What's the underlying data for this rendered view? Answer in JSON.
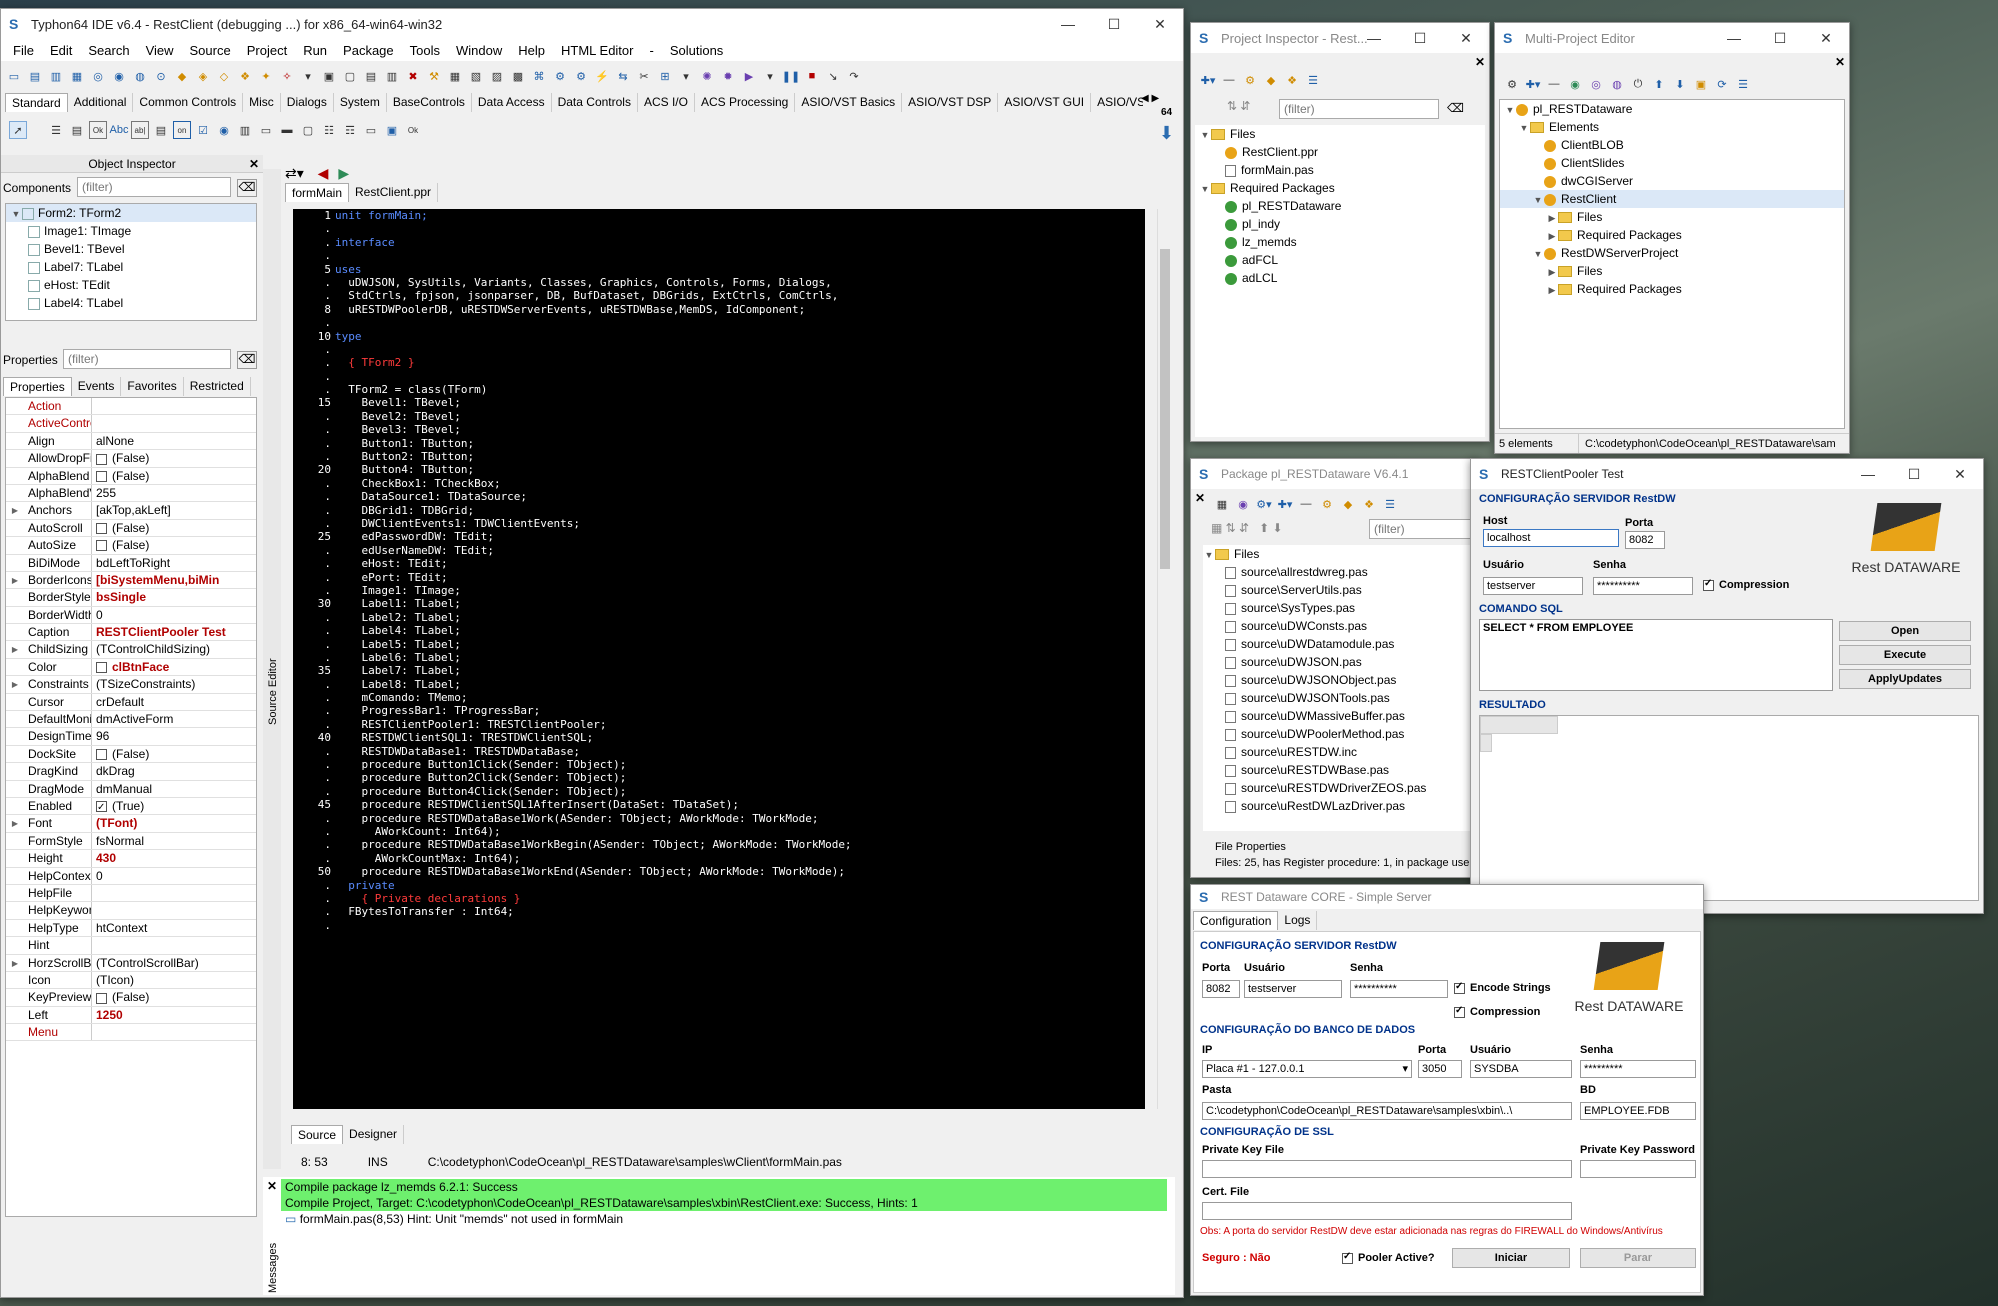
{
  "ide": {
    "title": "Typhon64 IDE v6.4 - RestClient (debugging ...) for x86_64-win64-win32",
    "menu": [
      "File",
      "Edit",
      "Search",
      "View",
      "Source",
      "Project",
      "Run",
      "Package",
      "Tools",
      "Window",
      "Help",
      "HTML Editor",
      "-",
      "Solutions"
    ],
    "palette_tabs": [
      "Standard",
      "Additional",
      "Common Controls",
      "Misc",
      "Dialogs",
      "System",
      "BaseControls",
      "Data Access",
      "Data Controls",
      "ACS I/O",
      "ACS Processing",
      "ASIO/VST Basics",
      "ASIO/VST DSP",
      "ASIO/VST GUI",
      "ASIO/VST C"
    ],
    "palette_icon_label": "64"
  },
  "object_inspector": {
    "title": "Object Inspector",
    "components_label": "Components",
    "filter_placeholder": "(filter)",
    "tree": [
      "Form2: TForm2",
      "Image1: TImage",
      "Bevel1: TBevel",
      "Label7: TLabel",
      "eHost: TEdit",
      "Label4: TLabel"
    ],
    "properties_label": "Properties",
    "tabs": [
      "Properties",
      "Events",
      "Favorites",
      "Restricted"
    ],
    "props": [
      {
        "name": "Action",
        "value": "",
        "red": true
      },
      {
        "name": "ActiveControl",
        "value": "",
        "red": true
      },
      {
        "name": "Align",
        "value": "alNone"
      },
      {
        "name": "AllowDropFiles",
        "value": "(False)",
        "check": false
      },
      {
        "name": "AlphaBlend",
        "value": "(False)",
        "check": false
      },
      {
        "name": "AlphaBlendValu",
        "value": "255"
      },
      {
        "name": "Anchors",
        "value": "[akTop,akLeft]",
        "exp": true
      },
      {
        "name": "AutoScroll",
        "value": "(False)",
        "check": false
      },
      {
        "name": "AutoSize",
        "value": "(False)",
        "check": false
      },
      {
        "name": "BiDiMode",
        "value": "bdLeftToRight"
      },
      {
        "name": "BorderIcons",
        "value": "[biSystemMenu,biMin",
        "exp": true,
        "bold": true
      },
      {
        "name": "BorderStyle",
        "value": "bsSingle",
        "bold": true
      },
      {
        "name": "BorderWidth",
        "value": "0"
      },
      {
        "name": "Caption",
        "value": "RESTClientPooler Test",
        "bold": true
      },
      {
        "name": "ChildSizing",
        "value": "(TControlChildSizing)",
        "exp": true
      },
      {
        "name": "Color",
        "value": "clBtnFace",
        "bold": true,
        "swatch": true
      },
      {
        "name": "Constraints",
        "value": "(TSizeConstraints)",
        "exp": true
      },
      {
        "name": "Cursor",
        "value": "crDefault"
      },
      {
        "name": "DefaultMonitor",
        "value": "dmActiveForm"
      },
      {
        "name": "DesignTimePPI",
        "value": "96"
      },
      {
        "name": "DockSite",
        "value": "(False)",
        "check": false
      },
      {
        "name": "DragKind",
        "value": "dkDrag"
      },
      {
        "name": "DragMode",
        "value": "dmManual"
      },
      {
        "name": "Enabled",
        "value": "(True)",
        "check": true
      },
      {
        "name": "Font",
        "value": "(TFont)",
        "exp": true,
        "bold": true
      },
      {
        "name": "FormStyle",
        "value": "fsNormal"
      },
      {
        "name": "Height",
        "value": "430",
        "bold": true
      },
      {
        "name": "HelpContext",
        "value": "0"
      },
      {
        "name": "HelpFile",
        "value": ""
      },
      {
        "name": "HelpKeyword",
        "value": ""
      },
      {
        "name": "HelpType",
        "value": "htContext"
      },
      {
        "name": "Hint",
        "value": ""
      },
      {
        "name": "HorzScrollBar",
        "value": "(TControlScrollBar)",
        "exp": true
      },
      {
        "name": "Icon",
        "value": "(TIcon)"
      },
      {
        "name": "KeyPreview",
        "value": "(False)",
        "check": false
      },
      {
        "name": "Left",
        "value": "1250",
        "bold": true
      },
      {
        "name": "Menu",
        "value": "",
        "red": true
      }
    ]
  },
  "editor": {
    "tabs": [
      "formMain",
      "RestClient.ppr"
    ],
    "side_label": "Source Editor",
    "bottom_tabs": [
      "Source",
      "Designer"
    ],
    "cursor_pos": "8: 53",
    "mode": "INS",
    "file_path": "C:\\codetyphon\\CodeOcean\\pl_RESTDataware\\samples\\wClient\\formMain.pas",
    "gutter": [
      "1",
      ".",
      ".",
      ".",
      "5",
      ".",
      ".",
      "8",
      ".",
      "10",
      ".",
      ".",
      ".",
      ".",
      "15",
      ".",
      ".",
      ".",
      ".",
      "20",
      ".",
      ".",
      ".",
      ".",
      "25",
      ".",
      ".",
      ".",
      ".",
      "30",
      ".",
      ".",
      ".",
      ".",
      "35",
      ".",
      ".",
      ".",
      ".",
      "40",
      ".",
      ".",
      ".",
      ".",
      "45",
      ".",
      ".",
      ".",
      ".",
      "50",
      ".",
      ".",
      ".",
      "."
    ],
    "lines": [
      "unit formMain;",
      "",
      "interface",
      "",
      "uses",
      "  uDWJSON, SysUtils, Variants, Classes, Graphics, Controls, Forms, Dialogs,",
      "  StdCtrls, fpjson, jsonparser, DB, BufDataset, DBGrids, ExtCtrls, ComCtrls,",
      "  uRESTDWPoolerDB, uRESTDWServerEvents, uRESTDWBase,MemDS, IdComponent;",
      "",
      "type",
      "",
      "  { TForm2 }",
      "",
      "  TForm2 = class(TForm)",
      "    Bevel1: TBevel;",
      "    Bevel2: TBevel;",
      "    Bevel3: TBevel;",
      "    Button1: TButton;",
      "    Button2: TButton;",
      "    Button4: TButton;",
      "    CheckBox1: TCheckBox;",
      "    DataSource1: TDataSource;",
      "    DBGrid1: TDBGrid;",
      "    DWClientEvents1: TDWClientEvents;",
      "    edPasswordDW: TEdit;",
      "    edUserNameDW: TEdit;",
      "    eHost: TEdit;",
      "    ePort: TEdit;",
      "    Image1: TImage;",
      "    Label1: TLabel;",
      "    Label2: TLabel;",
      "    Label4: TLabel;",
      "    Label5: TLabel;",
      "    Label6: TLabel;",
      "    Label7: TLabel;",
      "    Label8: TLabel;",
      "    mComando: TMemo;",
      "    ProgressBar1: TProgressBar;",
      "    RESTClientPooler1: TRESTClientPooler;",
      "    RESTDWClientSQL1: TRESTDWClientSQL;",
      "    RESTDWDataBase1: TRESTDWDataBase;",
      "    procedure Button1Click(Sender: TObject);",
      "    procedure Button2Click(Sender: TObject);",
      "    procedure Button4Click(Sender: TObject);",
      "    procedure RESTDWClientSQL1AfterInsert(DataSet: TDataSet);",
      "    procedure RESTDWDataBase1Work(ASender: TObject; AWorkMode: TWorkMode;",
      "      AWorkCount: Int64);",
      "    procedure RESTDWDataBase1WorkBegin(ASender: TObject; AWorkMode: TWorkMode;",
      "      AWorkCountMax: Int64);",
      "    procedure RESTDWDataBase1WorkEnd(ASender: TObject; AWorkMode: TWorkMode);",
      "  private",
      "    { Private declarations }",
      "  FBytesToTransfer : Int64;"
    ]
  },
  "messages": {
    "side_label": "Messages",
    "lines": [
      "Compile package lz_memds 6.2.1: Success",
      "Compile Project, Target: C:\\codetyphon\\CodeOcean\\pl_RESTDataware\\samples\\xbin\\RestClient.exe: Success, Hints: 1",
      "formMain.pas(8,53) Hint: Unit \"memds\" not used in formMain"
    ]
  },
  "project_inspector": {
    "title": "Project Inspector - Rest...",
    "filter_placeholder": "(filter)",
    "tree": [
      {
        "label": "Files",
        "lvl": 0,
        "icon": "folder"
      },
      {
        "label": "RestClient.ppr",
        "lvl": 1,
        "icon": "yellow"
      },
      {
        "label": "formMain.pas",
        "lvl": 1,
        "icon": "file"
      },
      {
        "label": "Required Packages",
        "lvl": 0,
        "icon": "folder"
      },
      {
        "label": "pl_RESTDataware",
        "lvl": 1,
        "icon": "green"
      },
      {
        "label": "pl_indy",
        "lvl": 1,
        "icon": "green"
      },
      {
        "label": "lz_memds",
        "lvl": 1,
        "icon": "green"
      },
      {
        "label": "adFCL",
        "lvl": 1,
        "icon": "green"
      },
      {
        "label": "adLCL",
        "lvl": 1,
        "icon": "green"
      }
    ]
  },
  "multi_project": {
    "title": "Multi-Project Editor",
    "tree": [
      {
        "label": "pl_RESTDataware",
        "lvl": 0,
        "icon": "yellow"
      },
      {
        "label": "Elements",
        "lvl": 1,
        "icon": "folder"
      },
      {
        "label": "ClientBLOB",
        "lvl": 2,
        "icon": "yellow"
      },
      {
        "label": "ClientSlides",
        "lvl": 2,
        "icon": "yellow"
      },
      {
        "label": "dwCGIServer",
        "lvl": 2,
        "icon": "yellow"
      },
      {
        "label": "RestClient",
        "lvl": 2,
        "icon": "yellow",
        "selected": true
      },
      {
        "label": "Files",
        "lvl": 3,
        "icon": "folder"
      },
      {
        "label": "Required Packages",
        "lvl": 3,
        "icon": "folder"
      },
      {
        "label": "RestDWServerProject",
        "lvl": 2,
        "icon": "yellow"
      },
      {
        "label": "Files",
        "lvl": 3,
        "icon": "folder"
      },
      {
        "label": "Required Packages",
        "lvl": 3,
        "icon": "folder"
      }
    ],
    "status_count": "5 elements",
    "status_path": "C:\\codetyphon\\CodeOcean\\pl_RESTDataware\\sam"
  },
  "package_window": {
    "title": "Package pl_RESTDataware V6.4.1",
    "filter_placeholder": "(filter)",
    "files_label": "Files",
    "files": [
      "source\\allrestdwreg.pas",
      "source\\ServerUtils.pas",
      "source\\SysTypes.pas",
      "source\\uDWConsts.pas",
      "source\\uDWDatamodule.pas",
      "source\\uDWJSON.pas",
      "source\\uDWJSONObject.pas",
      "source\\uDWJSONTools.pas",
      "source\\uDWMassiveBuffer.pas",
      "source\\uDWPoolerMethod.pas",
      "source\\uRESTDW.inc",
      "source\\uRESTDWBase.pas",
      "source\\uRESTDWDriverZEOS.pas",
      "source\\uRestDWLazDriver.pas"
    ],
    "file_props_label": "File Properties",
    "status": "Files: 25, has Register procedure: 1, in package use"
  },
  "client_pooler": {
    "title": "RESTClientPooler Test",
    "section_server": "CONFIGURAÇÃO SERVIDOR RestDW",
    "host_label": "Host",
    "host_value": "localhost",
    "port_label": "Porta",
    "port_value": "8082",
    "user_label": "Usuário",
    "user_value": "testserver",
    "pass_label": "Senha",
    "pass_value": "**********",
    "compression_label": "Compression",
    "section_sql": "COMANDO SQL",
    "sql_value": "SELECT * FROM EMPLOYEE",
    "btn_open": "Open",
    "btn_execute": "Execute",
    "btn_apply": "ApplyUpdates",
    "section_result": "RESULTADO",
    "logo_text": "Rest DATAWARE"
  },
  "simple_server": {
    "title": "REST Dataware CORE - Simple Server",
    "tabs": [
      "Configuration",
      "Logs"
    ],
    "section_server": "CONFIGURAÇÃO SERVIDOR RestDW",
    "port_label": "Porta",
    "port_value": "8082",
    "user_label": "Usuário",
    "user_value": "testserver",
    "pass_label": "Senha",
    "pass_value": "**********",
    "encode_label": "Encode Strings",
    "compression_label": "Compression",
    "section_db": "CONFIGURAÇÃO DO BANCO DE DADOS",
    "ip_label": "IP",
    "ip_value": "Placa #1 - 127.0.0.1",
    "db_port_label": "Porta",
    "db_port_value": "3050",
    "db_user_label": "Usuário",
    "db_user_value": "SYSDBA",
    "db_pass_label": "Senha",
    "db_pass_value": "*********",
    "path_label": "Pasta",
    "path_value": "C:\\codetyphon\\CodeOcean\\pl_RESTDataware\\samples\\xbin\\..\\",
    "bd_label": "BD",
    "bd_value": "EMPLOYEE.FDB",
    "section_ssl": "CONFIGURAÇÃO DE SSL",
    "pk_label": "Private Key File",
    "pkp_label": "Private Key Password",
    "cert_label": "Cert. File",
    "note": "Obs: A porta do servidor RestDW deve estar adicionada nas regras do FIREWALL do Windows/Antivírus",
    "secure": "Seguro : Não",
    "pooler_label": "Pooler Active?",
    "btn_start": "Iniciar",
    "btn_stop": "Parar",
    "logo_text": "Rest DATAWARE"
  },
  "colors": {
    "accent": "#00328a",
    "green_msg": "#6ef06e",
    "warn": "#d00000"
  }
}
